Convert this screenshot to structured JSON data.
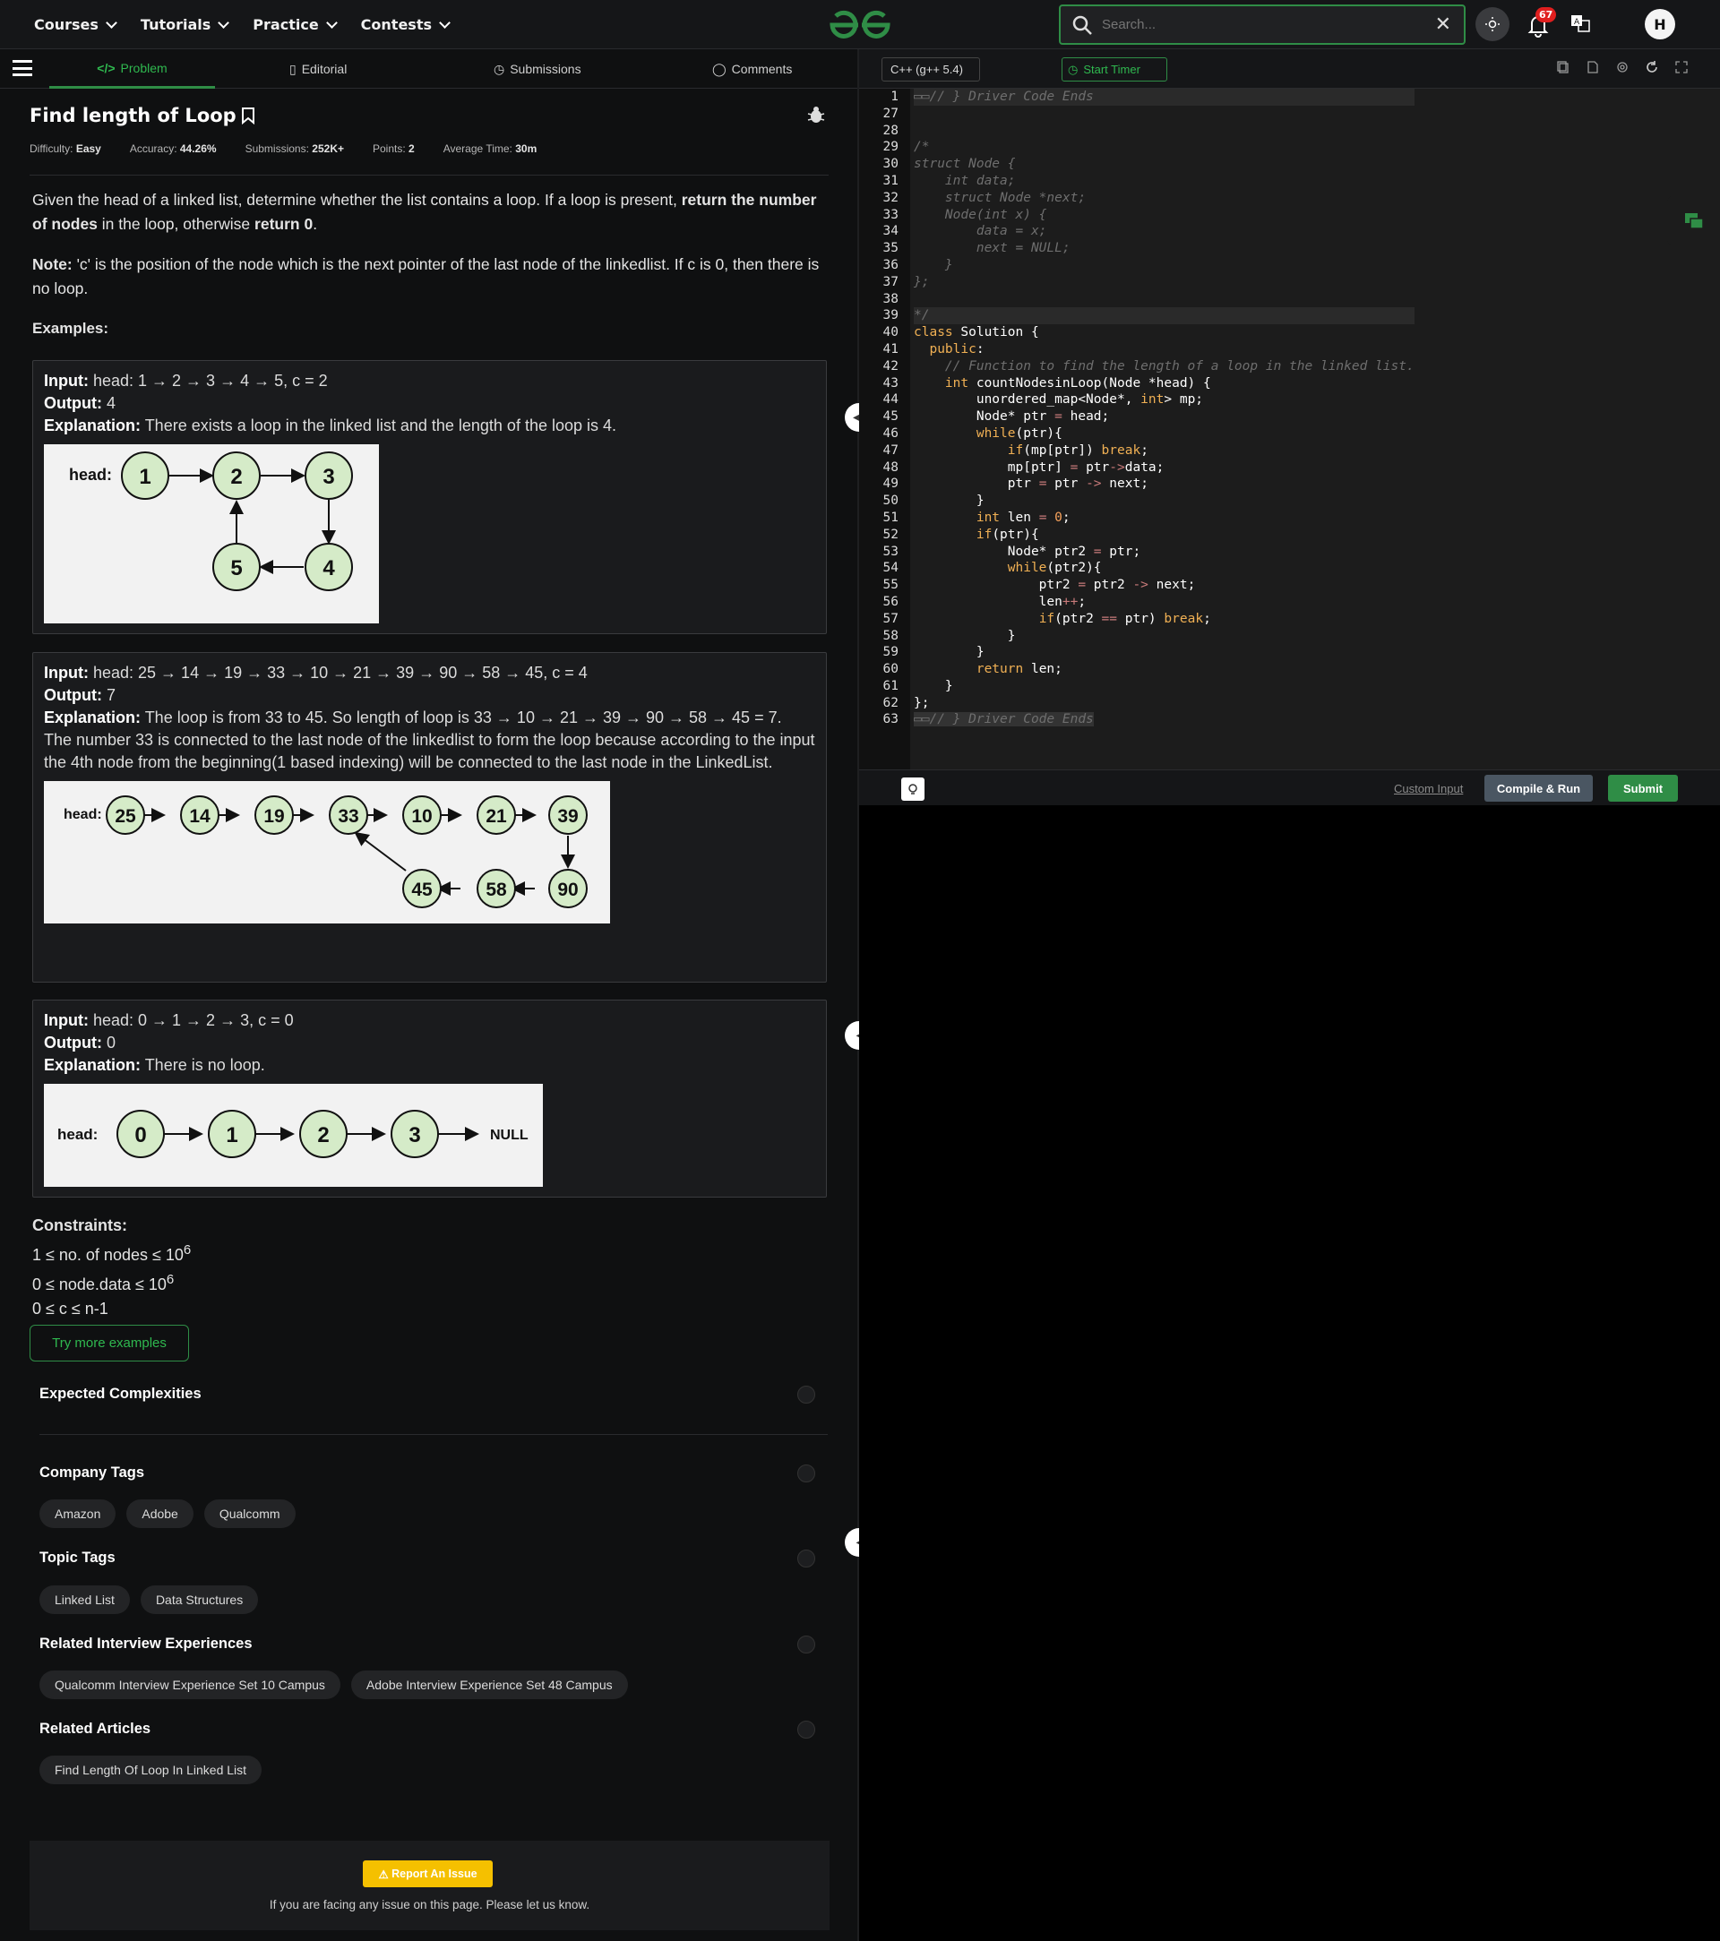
{
  "nav": {
    "items": [
      "Courses",
      "Tutorials",
      "Practice",
      "Contests"
    ]
  },
  "search": {
    "placeholder": "Search..."
  },
  "notifications": {
    "count": "67"
  },
  "user": {
    "initial": "H"
  },
  "tabs": {
    "problem": "Problem",
    "editorial": "Editorial",
    "submissions": "Submissions",
    "comments": "Comments"
  },
  "problem": {
    "title": "Find length of Loop",
    "difficulty_label": "Difficulty:",
    "difficulty": "Easy",
    "accuracy_label": "Accuracy:",
    "accuracy": "44.26%",
    "submissions_label": "Submissions:",
    "submissions": "252K+",
    "points_label": "Points:",
    "points": "2",
    "avgtime_label": "Average Time:",
    "avgtime": "30m",
    "desc1_a": "Given the head of a linked list, determine whether the list contains a loop. If a loop is present, ",
    "desc1_b": "return the number of nodes",
    "desc1_c": " in the loop, otherwise ",
    "desc1_d": "return 0",
    "desc1_e": ".",
    "note_label": "Note:",
    "note": " 'c' is the position of the node which is the next pointer of the last node of the linkedlist. If c is 0, then there is no loop.",
    "examples_label": "Examples:"
  },
  "examples": [
    {
      "input_label": "Input:",
      "input": " head: 1 → 2 → 3 → 4 → 5, c = 2",
      "output_label": "Output:",
      "output": " 4",
      "expl_label": "Explanation:",
      "expl": " There exists a loop in the linked list and the length of the loop is 4.",
      "nodes": [
        "1",
        "2",
        "3",
        "4",
        "5"
      ],
      "head": "head:"
    },
    {
      "input_label": "Input:",
      "input": " head: 25 → 14 → 19 → 33 → 10 → 21 → 39 → 90 → 58 → 45, c = 4",
      "output_label": "Output:",
      "output": " 7",
      "expl_label": "Explanation:",
      "expl": " The loop is from 33 to 45. So length of loop is 33 → 10 → 21 → 39 → 90 → 58 → 45 = 7.",
      "expl2": "The number 33 is connected to the last node of the linkedlist to form the loop because according to the input the 4th node from the beginning(1 based indexing) will be connected to the last node in the LinkedList.",
      "nodes": [
        "25",
        "14",
        "19",
        "33",
        "10",
        "21",
        "39",
        "90",
        "58",
        "45"
      ],
      "head": "head:"
    },
    {
      "input_label": "Input:",
      "input": " head: 0 → 1 → 2 → 3, c = 0",
      "output_label": "Output:",
      "output": " 0",
      "expl_label": "Explanation:",
      "expl": " There is no loop.",
      "nodes": [
        "0",
        "1",
        "2",
        "3"
      ],
      "head": "head:",
      "tail": "NULL"
    }
  ],
  "constraints": {
    "label": "Constraints:",
    "c1": "1 ≤ no. of nodes ≤ 10",
    "c1_sup": "6",
    "c2": "0 ≤ node.data ≤ 10",
    "c2_sup": "6",
    "c3": "0 ≤ c ≤ n-1"
  },
  "try_more": "Try more examples",
  "sections": {
    "complexities": "Expected Complexities",
    "company": "Company Tags",
    "company_tags": [
      "Amazon",
      "Adobe",
      "Qualcomm"
    ],
    "topic": "Topic Tags",
    "topic_tags": [
      "Linked List",
      "Data Structures"
    ],
    "interview": "Related Interview Experiences",
    "interview_tags": [
      "Qualcomm Interview Experience Set 10 Campus",
      "Adobe Interview Experience Set 48 Campus"
    ],
    "articles": "Related Articles",
    "article_tags": [
      "Find Length Of Loop In Linked List"
    ]
  },
  "report": {
    "button": "Report An Issue",
    "text": "If you are facing any issue on this page. Please let us know."
  },
  "editor": {
    "language": "C++ (g++ 5.4)",
    "timer": "Start Timer",
    "custom_input": "Custom Input",
    "compile": "Compile & Run",
    "submit": "Submit"
  },
  "colors": {
    "accent": "#2f8d46",
    "report": "#f5c000",
    "badge": "#e01f1f"
  }
}
